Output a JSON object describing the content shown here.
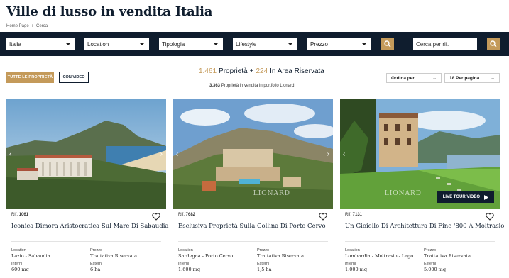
{
  "page": {
    "title": "Ville di lusso in vendita Italia",
    "breadcrumb": [
      "Home Page",
      "Cerca"
    ]
  },
  "filters": {
    "selects": [
      "Italia",
      "Location",
      "Tipologia",
      "Lifestyle",
      "Prezzo"
    ],
    "ref_placeholder": "Cerca per rif."
  },
  "toolbar": {
    "all_label": "TUTTE LE PROPRIETÀ",
    "video_label": "CON VIDEO",
    "count_main": "1.461",
    "count_word": "Proprietà",
    "plus": "+",
    "count_reserved": "224",
    "reserved_label": "In Area Riservata",
    "portfolio_count": "3.363",
    "portfolio_text": "Proprietà in vendita in portfolio Lionard",
    "sort_label": "Ordina per",
    "per_page_label": "18 Per pagina"
  },
  "labels": {
    "ref": "Rif.",
    "location": "Location",
    "price": "Prezzo",
    "interior": "Interni",
    "exterior": "Esterni",
    "watermark": "LIONARD",
    "live_tour": "LIVE TOUR VIDEO"
  },
  "listings": [
    {
      "ref": "1061",
      "title": "Iconica Dimora Aristocratica Sul Mare Di Sabaudia",
      "location": "Lazio - Sabaudia",
      "price": "Trattativa Riservata",
      "interior": "600 mq",
      "exterior": "6 ha"
    },
    {
      "ref": "7682",
      "title": "Esclusiva Proprietà Sulla Collina Di Porto Cervo",
      "location": "Sardegna - Porto Cervo",
      "price": "Trattativa Riservata",
      "interior": "1.600 mq",
      "exterior": "1,5 ha"
    },
    {
      "ref": "7131",
      "title": "Un Gioiello Di Architettura Di Fine '800 A Moltrasio",
      "location": "Lombardia - Moltrasio - Lago",
      "price": "Trattativa Riservata",
      "interior": "1.000 mq",
      "exterior": "5.000 mq"
    }
  ],
  "colors": {
    "navy": "#0f1d2e",
    "gold": "#c49a5a"
  }
}
